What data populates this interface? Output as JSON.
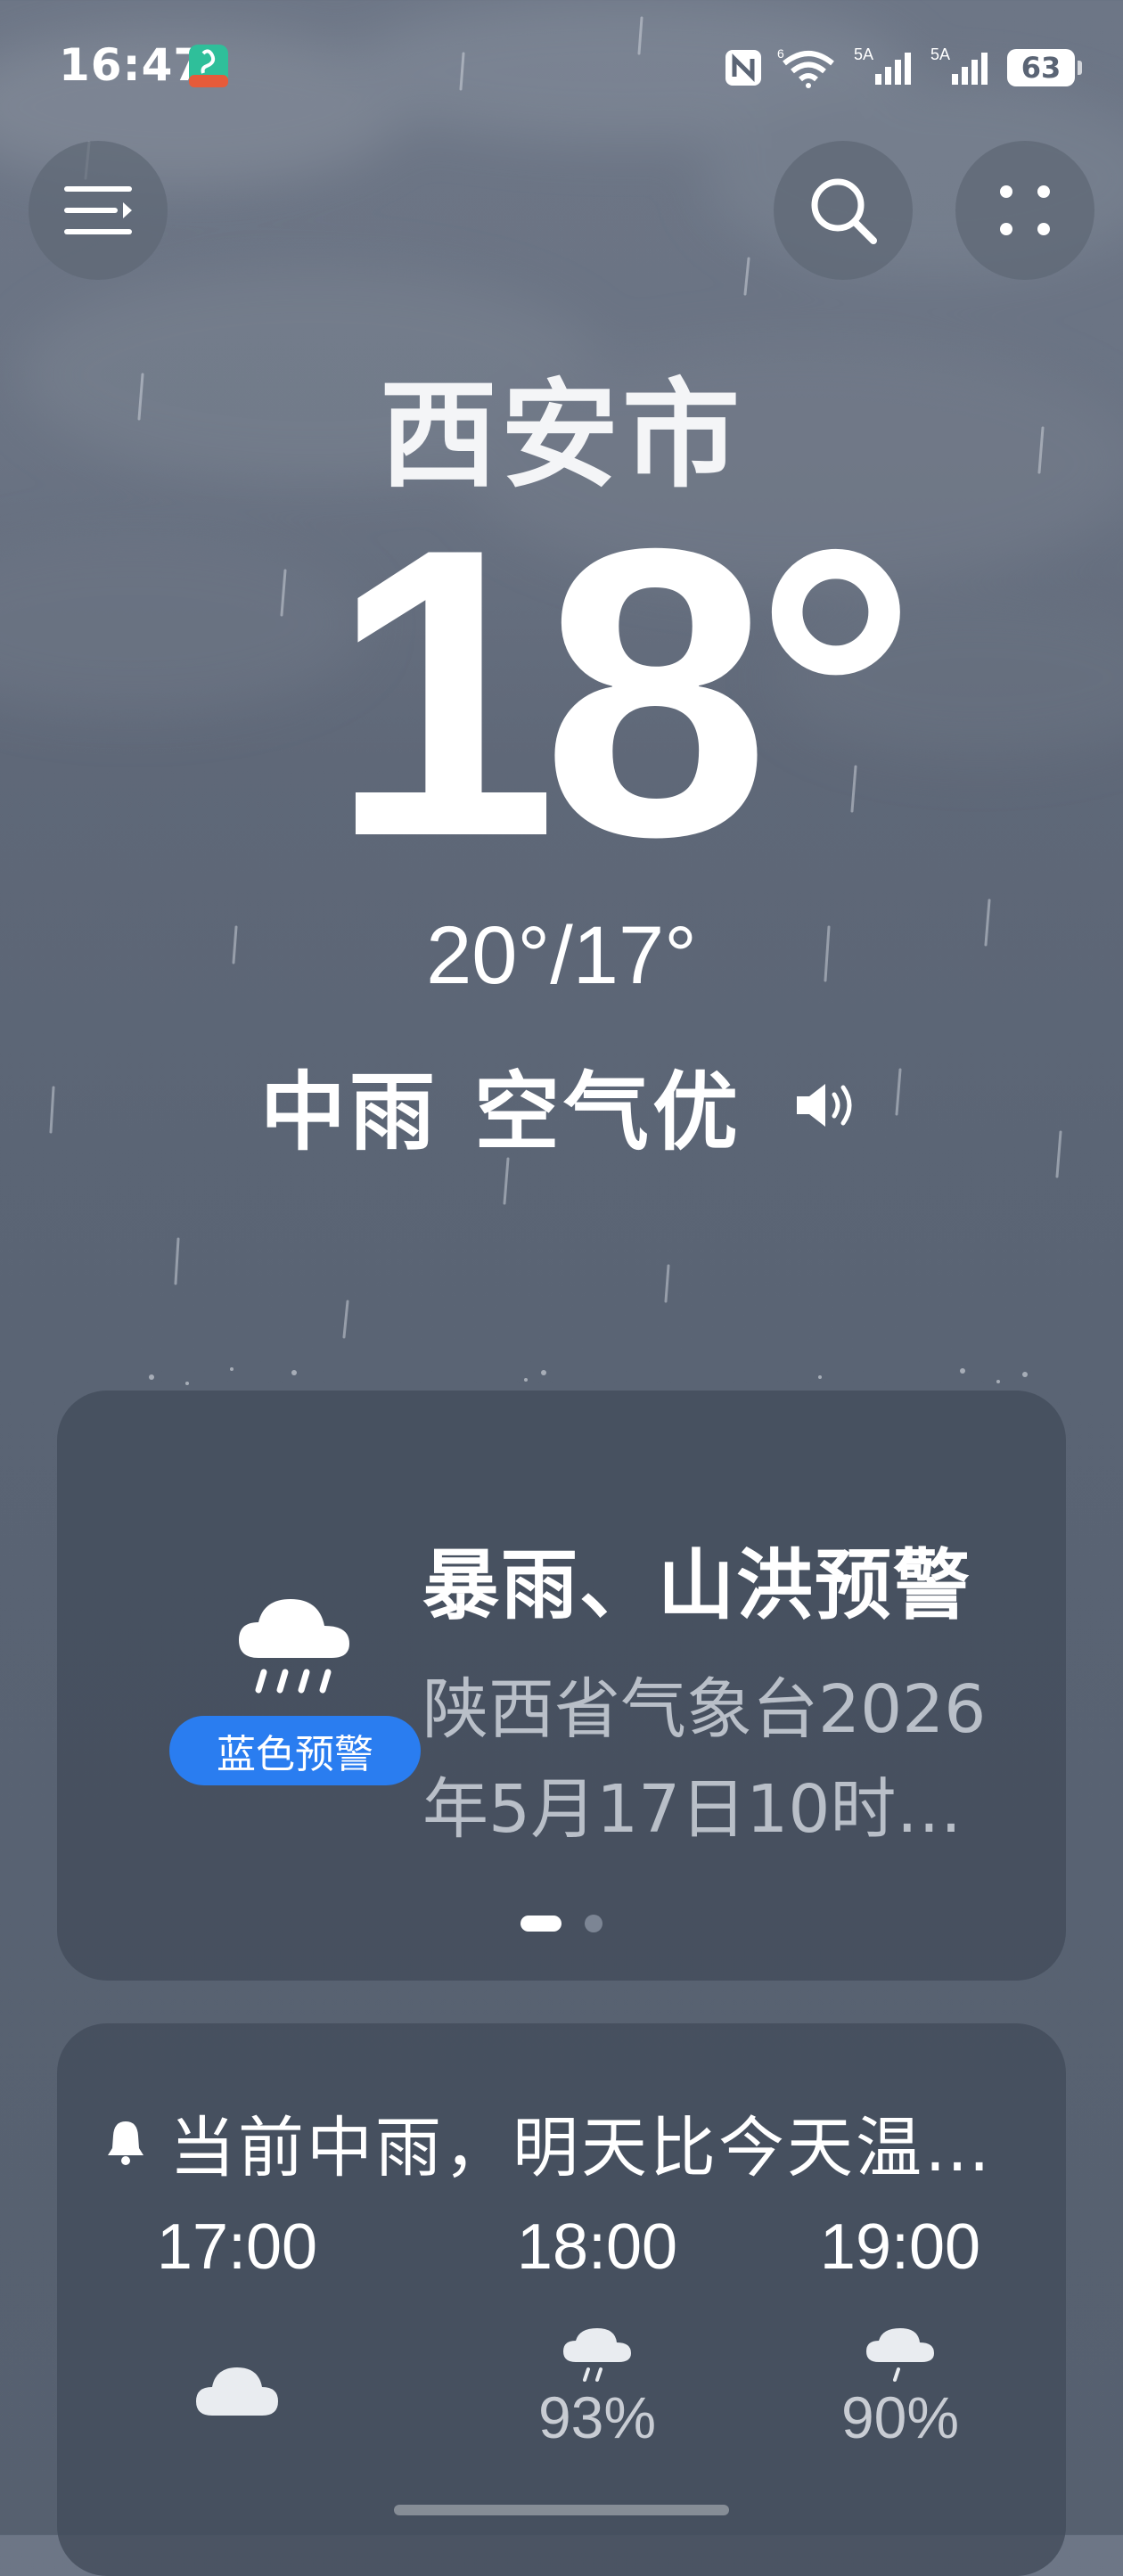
{
  "status_bar": {
    "time": "16:47",
    "battery": "63",
    "network_1": "6",
    "network_2": "5A",
    "network_3": "5A"
  },
  "header": {
    "menu_icon": "menu-icon",
    "search_icon": "search-icon",
    "more_icon": "grid-dots-icon"
  },
  "current": {
    "city": "西安市",
    "temperature": "18°",
    "high_low": "20°/17°",
    "condition": "中雨",
    "air_quality": "空气优"
  },
  "alert": {
    "title": "暴雨、山洪预警",
    "description": "陕西省气象台2026年5月17日10时…",
    "level": "蓝色预警",
    "level_color": "#2a7df0",
    "page_index": 1,
    "page_count": 2
  },
  "hourly": {
    "summary": "当前中雨，明天比今天温…",
    "items": [
      {
        "time": "17:00",
        "icon": "cloud-icon",
        "pop": ""
      },
      {
        "time": "18:00",
        "icon": "rain-cloud-icon",
        "pop": "93%"
      },
      {
        "time": "19:00",
        "icon": "rain-cloud-icon",
        "pop": "90%"
      }
    ]
  },
  "colors": {
    "background": "#5b6575",
    "card": "#434d5c",
    "accent_blue": "#2a7df0"
  }
}
